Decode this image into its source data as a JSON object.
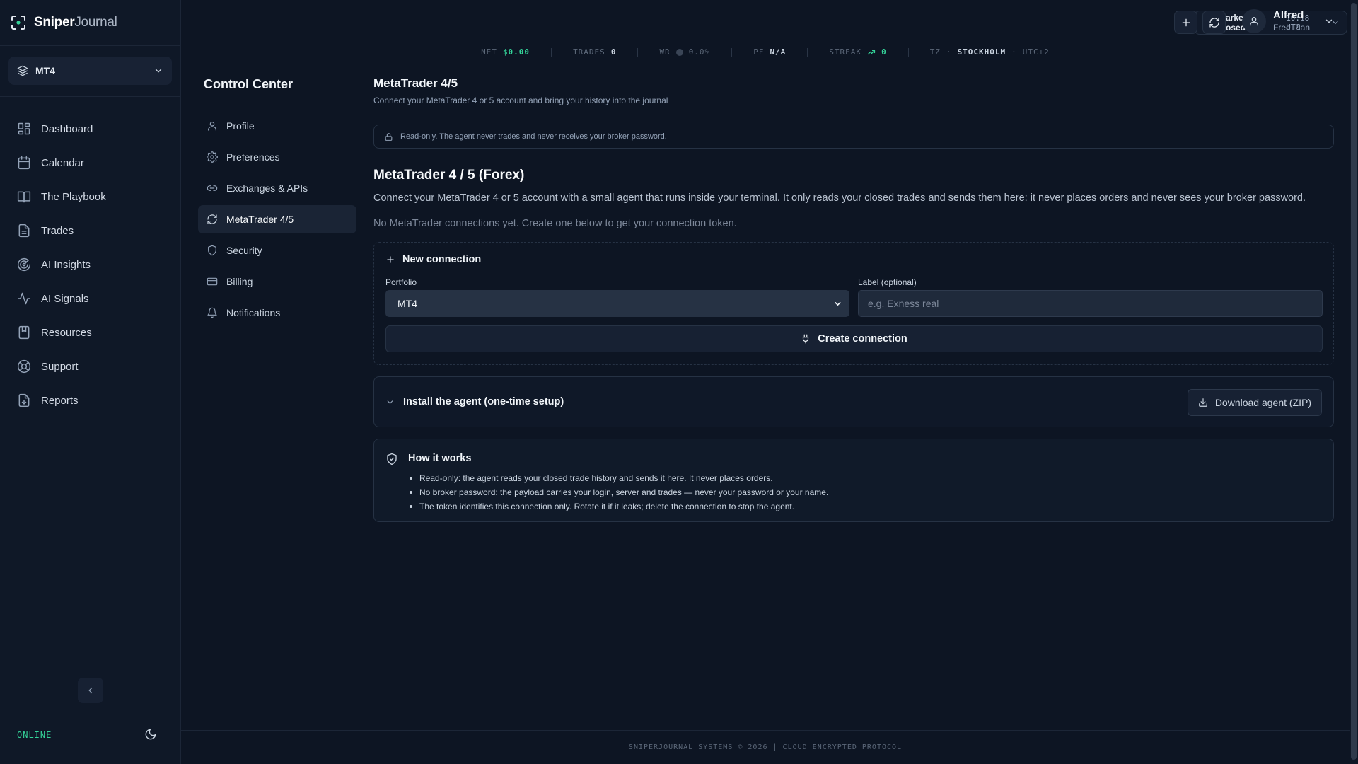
{
  "app": {
    "name_bold": "Sniper",
    "name_light": "Journal"
  },
  "sidebar": {
    "portfolio": "MT4",
    "items": [
      {
        "label": "Dashboard",
        "icon": "dashboard-icon"
      },
      {
        "label": "Calendar",
        "icon": "calendar-icon"
      },
      {
        "label": "The Playbook",
        "icon": "book-icon"
      },
      {
        "label": "Trades",
        "icon": "document-icon"
      },
      {
        "label": "AI Insights",
        "icon": "radar-icon"
      },
      {
        "label": "AI Signals",
        "icon": "activity-icon"
      },
      {
        "label": "Resources",
        "icon": "bookmark-icon"
      },
      {
        "label": "Support",
        "icon": "lifebuoy-icon"
      },
      {
        "label": "Reports",
        "icon": "file-download-icon"
      }
    ],
    "status": "ONLINE"
  },
  "header": {
    "market_status": "Markets closed",
    "market_time": "10:18 UTC",
    "user": {
      "name": "Alfred",
      "plan": "Free Plan"
    }
  },
  "ticker": {
    "net_label": "NET",
    "net_value": "$0.00",
    "trades_label": "TRADES",
    "trades_value": "0",
    "wr_label": "WR",
    "wr_value": "0.0%",
    "pf_label": "PF",
    "pf_value": "N/A",
    "streak_label": "STREAK",
    "streak_value": "0",
    "tz_label": "TZ",
    "tz_city": "STOCKHOLM",
    "tz_offset": "UTC+2"
  },
  "control_center": {
    "title": "Control Center",
    "items": [
      {
        "label": "Profile",
        "icon": "user-icon",
        "active": false
      },
      {
        "label": "Preferences",
        "icon": "gear-icon",
        "active": false
      },
      {
        "label": "Exchanges & APIs",
        "icon": "link-icon",
        "active": false
      },
      {
        "label": "MetaTrader 4/5",
        "icon": "refresh-icon",
        "active": true
      },
      {
        "label": "Security",
        "icon": "shield-icon",
        "active": false
      },
      {
        "label": "Billing",
        "icon": "credit-card-icon",
        "active": false
      },
      {
        "label": "Notifications",
        "icon": "bell-icon",
        "active": false
      }
    ]
  },
  "main": {
    "title": "MetaTrader 4/5",
    "subtitle": "Connect your MetaTrader 4 or 5 account and bring your history into the journal",
    "readonly_note": "Read-only. The agent never trades and never receives your broker password.",
    "mt_title": "MetaTrader 4 / 5 (Forex)",
    "mt_description": "Connect your MetaTrader 4 or 5 account with a small agent that runs inside your terminal. It only reads your closed trades and sends them here: it never places orders and never sees your broker password.",
    "empty_state": "No MetaTrader connections yet. Create one below to get your connection token.",
    "new_connection": {
      "title": "New connection",
      "portfolio_label": "Portfolio",
      "portfolio_value": "MT4",
      "label_label": "Label (optional)",
      "label_placeholder": "e.g. Exness real",
      "label_value": "",
      "create_button": "Create connection"
    },
    "install": {
      "title": "Install the agent (one-time setup)",
      "download_button": "Download agent (ZIP)"
    },
    "how_it_works": {
      "title": "How it works",
      "points": [
        "Read-only: the agent reads your closed trade history and sends it here. It never places orders.",
        "No broker password: the payload carries your login, server and trades — never your password or your name.",
        "The token identifies this connection only. Rotate it if it leaks; delete the connection to stop the agent."
      ]
    }
  },
  "footer": {
    "text": "SNIPERJOURNAL SYSTEMS © 2026 | CLOUD ENCRYPTED PROTOCOL"
  },
  "colors": {
    "background": "#0d1523",
    "accent_green": "#34d399",
    "panel": "#0f1827",
    "border": "#263244"
  }
}
